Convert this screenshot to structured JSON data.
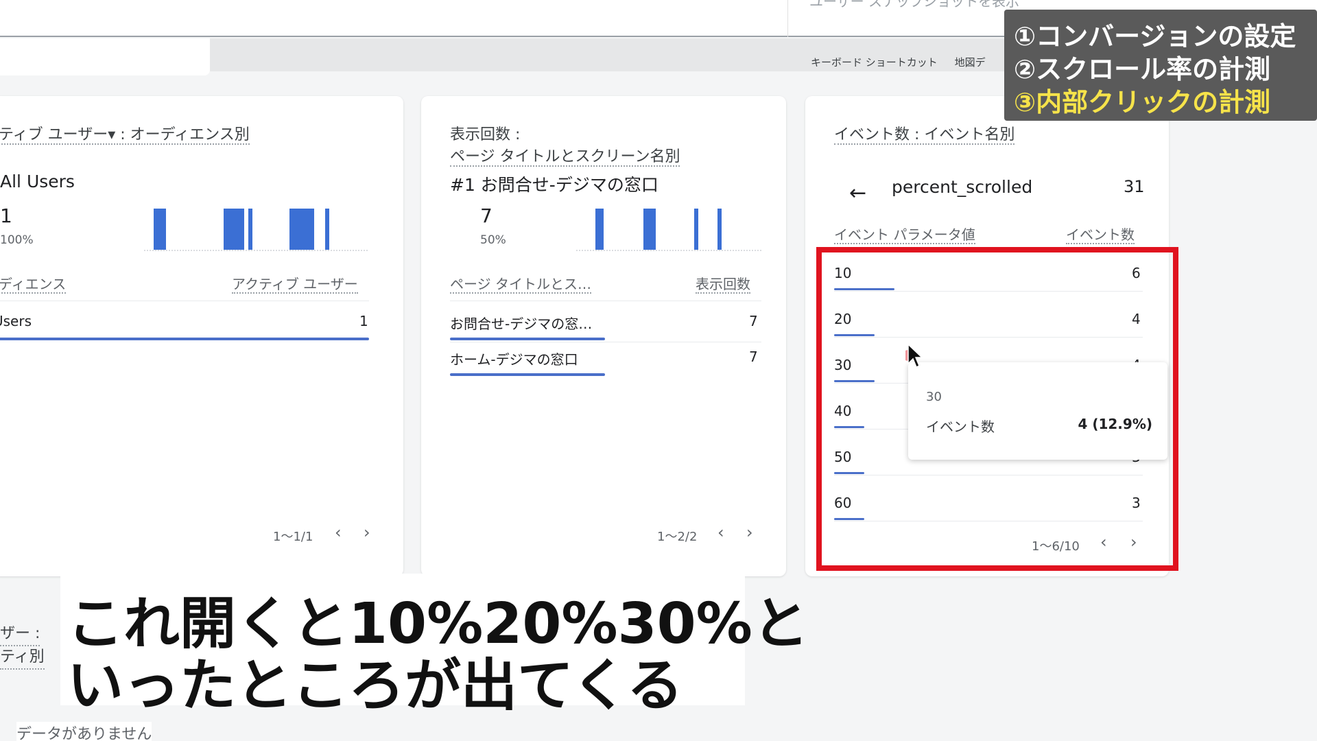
{
  "top_header": {
    "ghost_text": "ユーザー スナップショットを表示"
  },
  "shortcuts": {
    "keyboard": "キーボード ショートカット",
    "map": "地図デ"
  },
  "card1": {
    "title": "ティブ ユーザー▾ : オーディエンス別",
    "segment": "All Users",
    "value": "1",
    "percent": "100%",
    "col_left": "ディエンス",
    "col_right": "アクティブ ユーザー",
    "rows": [
      {
        "label": "Users",
        "value": "1"
      }
    ],
    "pager": "1〜1/1"
  },
  "card2": {
    "title_line1": "表示回数 :",
    "title_line2": "ページ タイトルとスクリーン名別",
    "rank_label": "#1  お問合せ-デジマの窓口",
    "value": "7",
    "percent": "50%",
    "col_left": "ページ タイトルとス…",
    "col_right": "表示回数",
    "rows": [
      {
        "label": "お問合せ-デジマの窓…",
        "value": "7",
        "share": 1.0
      },
      {
        "label": "ホーム-デジマの窓口",
        "value": "7",
        "share": 1.0
      }
    ],
    "pager": "1〜2/2"
  },
  "card3": {
    "title": "イベント数 : イベント名別",
    "event_name": "percent_scrolled",
    "event_total": "31",
    "col_left": "イベント パラメータ値",
    "col_right": "イベント数",
    "rows": [
      {
        "label": "10",
        "value": "6",
        "share": 0.194
      },
      {
        "label": "20",
        "value": "4",
        "share": 0.129
      },
      {
        "label": "30",
        "value": "4",
        "share": 0.129
      },
      {
        "label": "40",
        "value": "",
        "share": 0.097
      },
      {
        "label": "50",
        "value": "3",
        "share": 0.097
      },
      {
        "label": "60",
        "value": "3",
        "share": 0.097
      }
    ],
    "pager": "1〜6/10"
  },
  "tooltip": {
    "param": "30",
    "metric_label": "イベント数",
    "metric_value": "4 (12.9%)"
  },
  "left_fragment": {
    "line1": "ザー :",
    "line2": "ティ別",
    "no_data": "データがありません"
  },
  "overlay": {
    "line1": "①コンバージョンの設定",
    "line2": "②スクロール率の計測",
    "line3": "③内部クリックの計測"
  },
  "subtitle": {
    "line1": "これ開くと10%20%30%と",
    "line2": "いったところが出てくる"
  },
  "icons": {
    "back": "←",
    "prev": "‹",
    "next": "›"
  },
  "colors": {
    "bar": "#3b6fd4",
    "highlight_box": "#e0131f",
    "overlay_highlight": "#f6e34a"
  }
}
